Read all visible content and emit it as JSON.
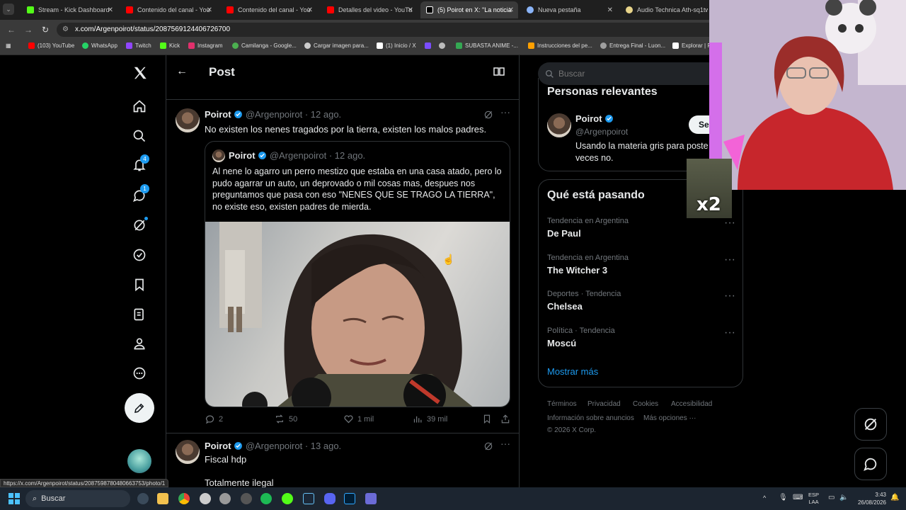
{
  "tabs": [
    {
      "label": "Stream - Kick Dashboard",
      "color": "#53fc18"
    },
    {
      "label": "Contenido del canal - You",
      "color": "#ff0000"
    },
    {
      "label": "Contenido del canal - You",
      "color": "#ff0000"
    },
    {
      "label": "Detalles del video - YouTu",
      "color": "#ff0000"
    },
    {
      "label": "(5) Poirot en X: \"La noticia",
      "color": "#ffffff"
    },
    {
      "label": "Nueva pestaña",
      "color": "#8ab4f8"
    },
    {
      "label": "Audio Technica Ath-sq1tw",
      "color": "#e8d48a"
    }
  ],
  "url": "x.com/Argenpoirot/status/2087569124406726700",
  "bookmarks": [
    {
      "label": "(103) YouTube",
      "color": "#ff0000"
    },
    {
      "label": "WhatsApp",
      "color": "#25d366"
    },
    {
      "label": "Twitch",
      "color": "#9146ff"
    },
    {
      "label": "Kick",
      "color": "#53fc18"
    },
    {
      "label": "Instagram",
      "color": "#e1306c"
    },
    {
      "label": "Camilanga - Google...",
      "color": "#4caf50"
    },
    {
      "label": "Cargar imagen para...",
      "color": "#cccccc"
    },
    {
      "label": "(1) Inicio / X",
      "color": "#ffffff"
    },
    {
      "label": "SUBASTA ANIME -...",
      "color": "#34a853"
    },
    {
      "label": "Instrucciones del pe...",
      "color": "#ffa000"
    },
    {
      "label": "Entrega Final - Luon...",
      "color": "#9e9e9e"
    },
    {
      "label": "Explorar | P",
      "color": "#ffffff"
    }
  ],
  "nav": {
    "notifications_badge": "4",
    "messages_badge": "1"
  },
  "header": {
    "title": "Post"
  },
  "tweet1": {
    "name": "Poirot",
    "handle": "@Argenpoirot",
    "date": "· 12 ago.",
    "text": "No existen los nenes tragados por la tierra, existen los malos padres.",
    "quote": {
      "name": "Poirot",
      "handle": "@Argenpoirot",
      "date": "· 12 ago.",
      "text": "Al nene lo agarro un perro mestizo que estaba en una casa atado, pero lo pudo agarrar un auto, un deprovado o mil cosas mas, despues nos preguntamos que pasa con eso \"NENES QUE SE TRAGO LA TIERRA\", no existe eso, existen padres de mierda."
    },
    "stats": {
      "replies": "2",
      "reposts": "50",
      "likes": "1 mil",
      "views": "39 mil"
    }
  },
  "tweet2": {
    "name": "Poirot",
    "handle": "@Argenpoirot",
    "date": "· 13 ago.",
    "line1": "Fiscal hdp",
    "line2": "Totalmente ilegal"
  },
  "search": {
    "placeholder": "Buscar"
  },
  "relevant": {
    "title": "Personas relevantes",
    "name": "Poirot",
    "handle": "@Argenpoirot",
    "follow_label": "Se",
    "bio": "Usando la materia gris para poste veces no."
  },
  "trends": {
    "title": "Qué está pasando",
    "items": [
      {
        "meta": "Tendencia en Argentina",
        "name": "De Paul"
      },
      {
        "meta": "Tendencia en Argentina",
        "name": "The Witcher 3"
      },
      {
        "meta": "Deportes · Tendencia",
        "name": "Chelsea"
      },
      {
        "meta": "Política · Tendencia",
        "name": "Moscú"
      }
    ],
    "show_more": "Mostrar más"
  },
  "footer": {
    "terms": "Términos",
    "privacy": "Privacidad",
    "cookies": "Cookies",
    "accessibility": "Accesibilidad",
    "ads": "Información sobre anuncios",
    "more": "Más opciones ···",
    "copyright": "© 2026 X Corp."
  },
  "overlay": {
    "multiplier": "x2"
  },
  "status_url": "https://x.com/Argenpoirot/status/2087598780480663753/photo/1",
  "taskbar": {
    "search": "Buscar",
    "lang1": "ESP",
    "lang2": "LAA",
    "time": "3:43",
    "date": "26/08/2026"
  },
  "colors": {
    "accent": "#1d9bf0",
    "background": "#000000",
    "border": "#2f3336"
  }
}
